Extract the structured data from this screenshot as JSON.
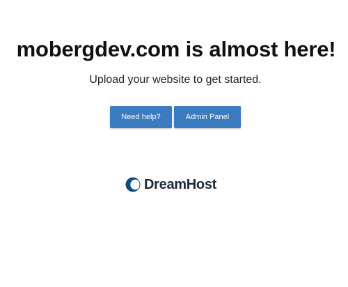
{
  "main": {
    "headline": "mobergdev.com is almost here!",
    "subtitle": "Upload your website to get started.",
    "buttons": {
      "help_label": "Need help?",
      "admin_label": "Admin Panel"
    },
    "logo": {
      "text": "DreamHost",
      "icon": "dreamhost-moon-icon"
    }
  },
  "colors": {
    "button_bg": "#3b7bbf",
    "button_text": "#ffffff",
    "logo_text": "#1d2a3a",
    "logo_mark": "#0f4c81",
    "heading": "#111111"
  }
}
